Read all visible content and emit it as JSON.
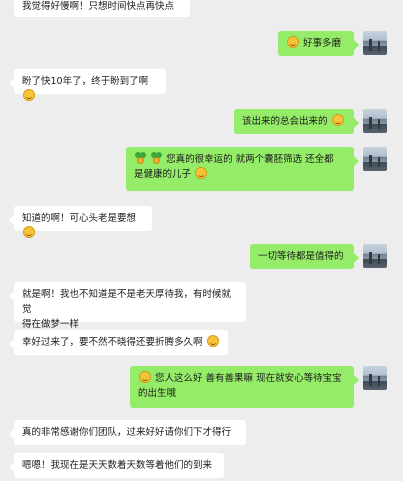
{
  "chat": {
    "messages": [
      {
        "side": "in",
        "text": "我觉得好慢啊！只想时间快点再快点"
      },
      {
        "side": "out",
        "text": "好事多磨",
        "emoji_before": "smiley-emoji"
      },
      {
        "side": "in",
        "text": "盼了快10年了，终于盼到了啊",
        "emoji_after": "smiley-emoji"
      },
      {
        "side": "out",
        "text": "该出来的总会出来的",
        "emoji_after": "smiley-emoji"
      },
      {
        "side": "out",
        "line1": "您真的很幸运的  就两个囊胚筛选  还全都",
        "line2": "是健康的儿子",
        "emoji_before": "sprout-emoji",
        "emoji_after": "smiley-emoji"
      },
      {
        "side": "in",
        "text": "知道的啊！可心头老是要想",
        "emoji_after": "smiley-emoji"
      },
      {
        "side": "out",
        "text": "一切等待都是值得的"
      },
      {
        "side": "in",
        "line1": "就是啊！我也不知道是不是老天厚待我，有时候就觉",
        "line2": "得在做梦一样"
      },
      {
        "side": "in",
        "text": "幸好过来了，要不然不晓得还要折腾多久啊",
        "emoji_after": "smiley-emoji"
      },
      {
        "side": "out",
        "line1": "您人这么好  善有善果嘛  现在就安心等待宝宝",
        "line2": "的出生哦",
        "emoji_before": "smiley-emoji"
      },
      {
        "side": "in",
        "text": "真的非常感谢你们团队，过来好好请你们下才得行"
      },
      {
        "side": "in",
        "text": "嗯嗯！我现在是天天数着天数等着他们的到来"
      }
    ]
  }
}
